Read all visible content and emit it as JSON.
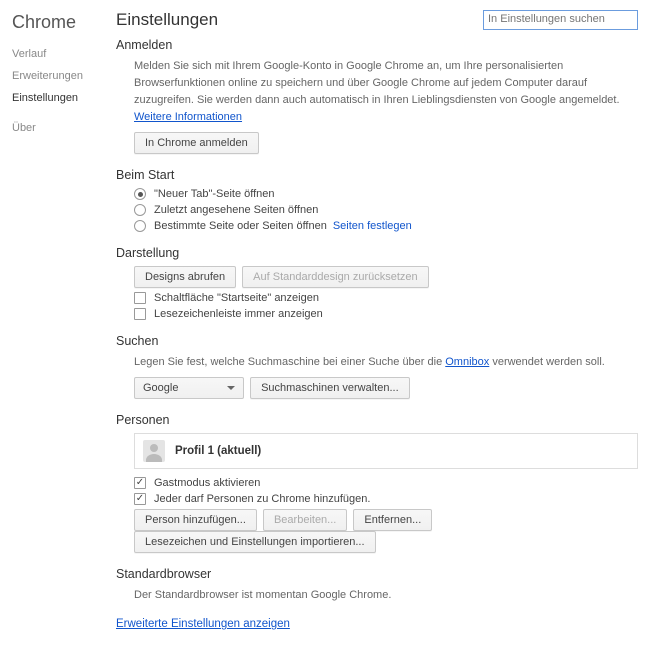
{
  "brand": "Chrome",
  "nav": {
    "verlauf": "Verlauf",
    "erweiterungen": "Erweiterungen",
    "einstellungen": "Einstellungen",
    "uber": "Über"
  },
  "title": "Einstellungen",
  "search_placeholder": "In Einstellungen suchen",
  "anmelden": {
    "heading": "Anmelden",
    "desc": "Melden Sie sich mit Ihrem Google-Konto in Google Chrome an, um Ihre personalisierten Browserfunktionen online zu speichern und über Google Chrome auf jedem Computer darauf zuzugreifen. Sie werden dann auch automatisch in Ihren Lieblingsdiensten von Google angemeldet. ",
    "more_link": "Weitere Informationen",
    "button": "In Chrome anmelden"
  },
  "start": {
    "heading": "Beim Start",
    "opt1": "\"Neuer Tab\"-Seite öffnen",
    "opt2": "Zuletzt angesehene Seiten öffnen",
    "opt3": "Bestimmte Seite oder Seiten öffnen",
    "opt3_link": "Seiten festlegen"
  },
  "darstellung": {
    "heading": "Darstellung",
    "btn_get": "Designs abrufen",
    "btn_reset": "Auf Standarddesign zurücksetzen",
    "chk1": "Schaltfläche \"Startseite\" anzeigen",
    "chk2": "Lesezeichenleiste immer anzeigen"
  },
  "suchen": {
    "heading": "Suchen",
    "desc1": "Legen Sie fest, welche Suchmaschine bei einer Suche über die ",
    "link": "Omnibox",
    "desc2": " verwendet werden soll.",
    "select_value": "Google",
    "btn_manage": "Suchmaschinen verwalten..."
  },
  "personen": {
    "heading": "Personen",
    "profile": "Profil 1 (aktuell)",
    "chk_guest": "Gastmodus aktivieren",
    "chk_add": "Jeder darf Personen zu Chrome hinzufügen.",
    "btn_add": "Person hinzufügen...",
    "btn_edit": "Bearbeiten...",
    "btn_remove": "Entfernen...",
    "btn_import": "Lesezeichen und Einstellungen importieren..."
  },
  "standard": {
    "heading": "Standardbrowser",
    "desc": "Der Standardbrowser ist momentan Google Chrome."
  },
  "advanced_link": "Erweiterte Einstellungen anzeigen"
}
